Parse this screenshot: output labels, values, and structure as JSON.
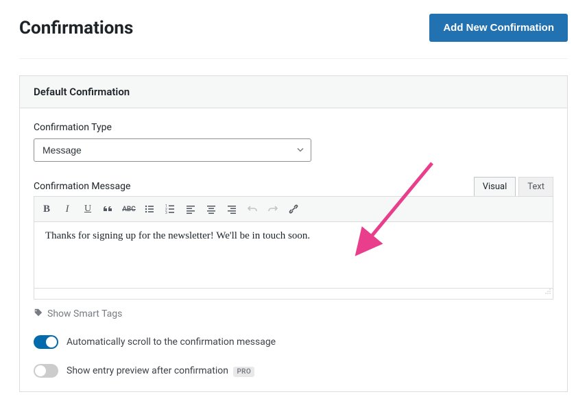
{
  "header": {
    "title": "Confirmations",
    "add_button": "Add New Confirmation"
  },
  "panel": {
    "title": "Default Confirmation"
  },
  "confirmation_type": {
    "label": "Confirmation Type",
    "value": "Message"
  },
  "confirmation_message": {
    "label": "Confirmation Message",
    "tabs": {
      "visual": "Visual",
      "text": "Text"
    },
    "body": "Thanks for signing up for the newsletter! We'll be in touch soon."
  },
  "smart_tags": {
    "label": "Show Smart Tags"
  },
  "auto_scroll": {
    "label": "Automatically scroll to the confirmation message",
    "enabled": true
  },
  "entry_preview": {
    "label": "Show entry preview after confirmation",
    "enabled": false,
    "badge": "PRO"
  },
  "annotation": {
    "arrow_color": "#e83e8c"
  }
}
